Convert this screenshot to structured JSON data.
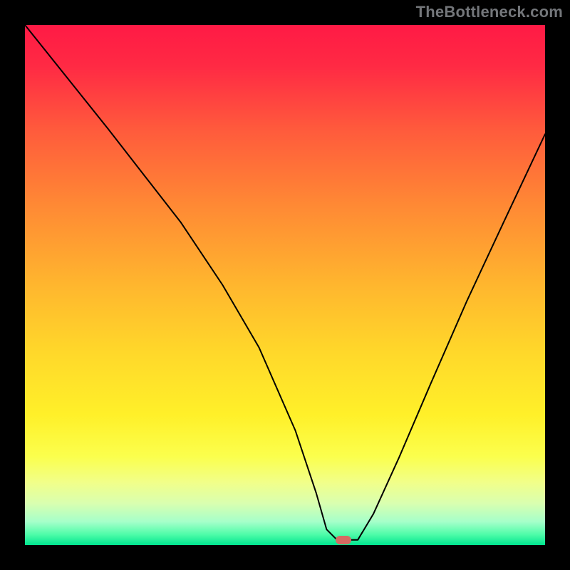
{
  "attribution": "TheBottleneck.com",
  "marker": {
    "x_pct": 61.2,
    "y_pct": 99.0,
    "color": "#d66a62"
  },
  "colors": {
    "frame": "#000000",
    "curve": "#000000",
    "gradient_stops": [
      {
        "offset": 0.0,
        "color": "#ff1a45"
      },
      {
        "offset": 0.08,
        "color": "#ff2a44"
      },
      {
        "offset": 0.2,
        "color": "#ff5a3c"
      },
      {
        "offset": 0.35,
        "color": "#ff8a34"
      },
      {
        "offset": 0.5,
        "color": "#ffb62e"
      },
      {
        "offset": 0.63,
        "color": "#ffd82a"
      },
      {
        "offset": 0.75,
        "color": "#fff029"
      },
      {
        "offset": 0.83,
        "color": "#fbff4d"
      },
      {
        "offset": 0.88,
        "color": "#f1ff8a"
      },
      {
        "offset": 0.92,
        "color": "#d9ffb0"
      },
      {
        "offset": 0.955,
        "color": "#a6ffca"
      },
      {
        "offset": 0.98,
        "color": "#4dfca8"
      },
      {
        "offset": 1.0,
        "color": "#00e58f"
      }
    ]
  },
  "chart_data": {
    "type": "line",
    "title": "",
    "xlabel": "",
    "ylabel": "",
    "xlim": [
      0,
      100
    ],
    "ylim": [
      0,
      100
    ],
    "grid": false,
    "legend": false,
    "note": "Values are approximate percentages read from the plot area. y=0 is the bottom (green), y=100 is the top (red). The curve descends from top-left to a flat minimum near x≈57–64 (y≈1) then rises again.",
    "series": [
      {
        "name": "bottleneck-curve",
        "x": [
          0,
          8,
          16,
          23,
          30,
          38,
          45,
          52,
          56,
          58,
          60,
          62,
          64,
          67,
          72,
          78,
          85,
          92,
          100
        ],
        "y": [
          100,
          90,
          80,
          71,
          62,
          50,
          38,
          22,
          10,
          3,
          1,
          1,
          1,
          6,
          17,
          31,
          47,
          62,
          79
        ]
      }
    ],
    "marker_point": {
      "x": 61.2,
      "y": 1
    }
  }
}
